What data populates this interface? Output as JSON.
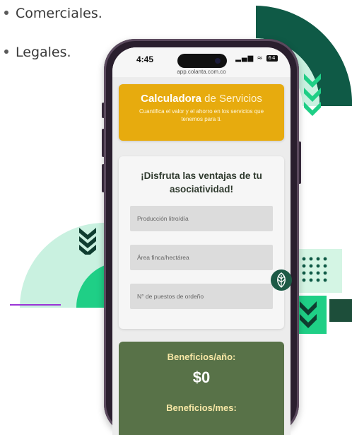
{
  "bullets": [
    "Comerciales.",
    "Legales."
  ],
  "phone": {
    "time": "4:45",
    "url": "app.colanta.com.co",
    "status_icons": "signal-wifi-battery",
    "battery_level": "64"
  },
  "calculator": {
    "title_bold": "Calculadora",
    "title_light": "de Servicios",
    "subtitle": "Cuantifica el valor y el ahorro en los servicios que tenemos para ti.",
    "color": "#e7ab0e"
  },
  "form": {
    "title": "¡Disfruta las ventajas de tu asociatividad!",
    "fields": [
      {
        "placeholder": "Producción litro/día"
      },
      {
        "placeholder": "Área finca/hectárea"
      },
      {
        "placeholder": "N° de puestos de ordeño"
      }
    ]
  },
  "benefits": {
    "year_label": "Beneficios/año:",
    "year_value": "$0",
    "month_label": "Beneficios/mes:",
    "color": "#587248"
  },
  "decor_colors": {
    "dark_green": "#0f5a46",
    "mint": "#c9f1e0",
    "bright_green": "#1fcf86",
    "purple_line": "#9b35d6",
    "leaf": "#1d5a46"
  },
  "icons": [
    "chevron-down-double-icon",
    "leaf-icon",
    "dot-grid-icon"
  ]
}
